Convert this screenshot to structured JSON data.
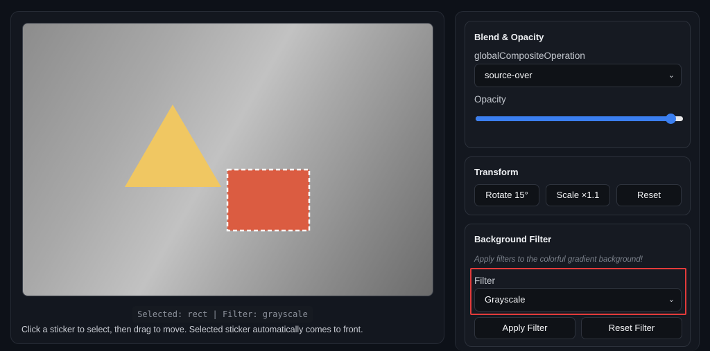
{
  "canvas": {
    "selected_status": "Selected: rect | Filter: grayscale",
    "hint": "Click a sticker to select, then drag to move. Selected sticker automatically comes to front."
  },
  "stickers": [
    {
      "type": "triangle",
      "color": "#f0c762"
    },
    {
      "type": "rect",
      "color": "#db5c41",
      "selected": true
    }
  ],
  "blend": {
    "title": "Blend & Opacity",
    "composite_label": "globalCompositeOperation",
    "composite_value": "source-over",
    "opacity_label": "Opacity",
    "opacity_value": 0.95
  },
  "transform": {
    "title": "Transform",
    "rotate_label": "Rotate 15°",
    "scale_label": "Scale ×1.1",
    "reset_label": "Reset"
  },
  "filter": {
    "title": "Background Filter",
    "note": "Apply filters to the colorful gradient background!",
    "filter_label": "Filter",
    "filter_value": "Grayscale",
    "apply_label": "Apply Filter",
    "reset_label": "Reset Filter"
  },
  "colors": {
    "accent": "#3b7ff0",
    "highlight": "#e33b3b"
  },
  "icons": {
    "select_arrow": "chevron-down-icon"
  }
}
